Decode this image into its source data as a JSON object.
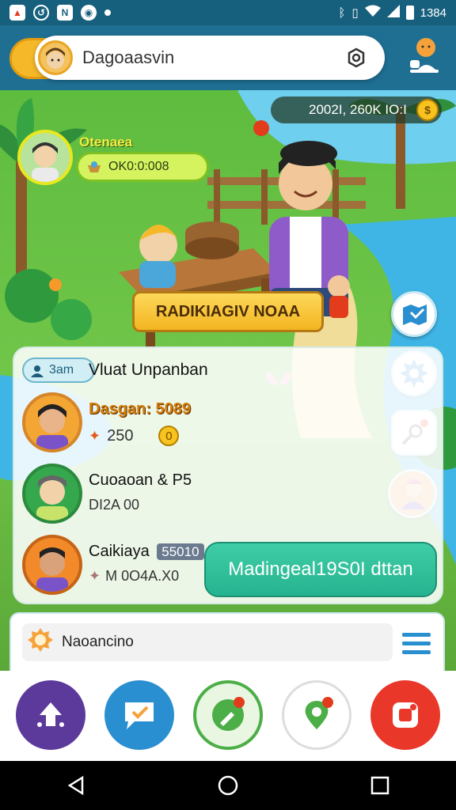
{
  "status_bar": {
    "time": "1384"
  },
  "search": {
    "value": "Dagoaasvin"
  },
  "scene": {
    "coins_text": "2002I, 260K IO:I",
    "coin_symbol": "$",
    "player": {
      "name": "Otenaea",
      "xp_text": "OK0:0:008"
    },
    "action_label": "RADIKIAGIV NOAA"
  },
  "panel": {
    "tag": "3am",
    "title": "Vluat Unpanban",
    "friends": [
      {
        "name": "Dasgan: 5089",
        "sub": "250",
        "badge": "0"
      },
      {
        "name": "Cuoaoan & P5",
        "sub": "DI2A 00"
      },
      {
        "name": "Caikiaya",
        "tag": "55010",
        "sub": "M 0O4A.X0"
      }
    ],
    "cta_label": "Madingeal19S0I dttan"
  },
  "notification": {
    "text": "Naoancino"
  },
  "colors": {
    "brand_yellow": "#f5b829",
    "accent_green": "#26b490",
    "sky_blue": "#1f6f93"
  }
}
